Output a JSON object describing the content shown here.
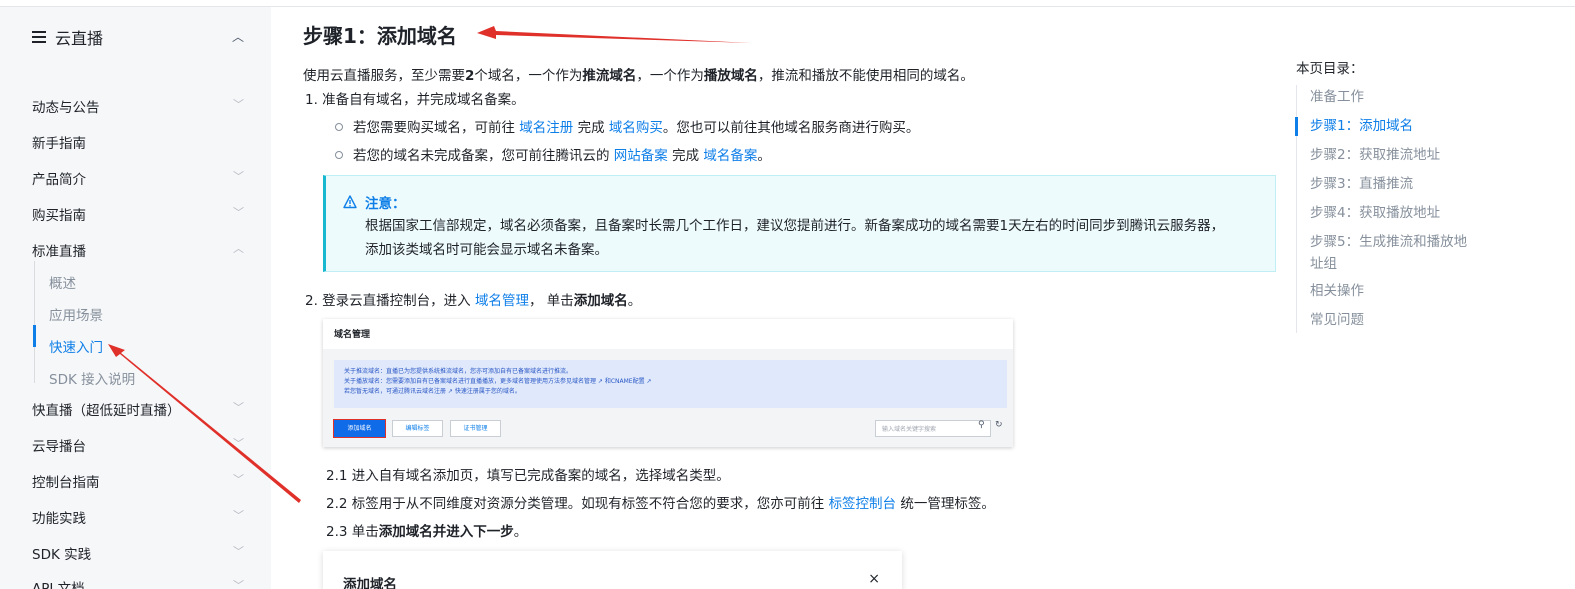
{
  "sidebar": {
    "title": "云直播",
    "items": [
      {
        "label": "动态与公告",
        "chevron": "down"
      },
      {
        "label": "新手指南",
        "chevron": ""
      },
      {
        "label": "产品简介",
        "chevron": "down"
      },
      {
        "label": "购买指南",
        "chevron": "down"
      },
      {
        "label": "标准直播",
        "chevron": "up"
      },
      {
        "label": "快直播（超低延时直播）",
        "chevron": "down"
      },
      {
        "label": "云导播台",
        "chevron": "down"
      },
      {
        "label": "控制台指南",
        "chevron": "down"
      },
      {
        "label": "功能实践",
        "chevron": "down"
      },
      {
        "label": "SDK 实践",
        "chevron": "down"
      },
      {
        "label": "API 文档",
        "chevron": "down"
      }
    ],
    "subitems": [
      "概述",
      "应用场景",
      "快速入门",
      "SDK 接入说明"
    ],
    "active_subitem": "快速入门"
  },
  "main": {
    "heading": "步骤1：添加域名",
    "intro": {
      "a": "使用云直播服务，至少需要",
      "b": "2",
      "c": "个域名，一个作为",
      "d": "推流域名",
      "e": "，一个作为",
      "f": "播放域名",
      "g": "，推流和播放不能使用相同的域名。"
    },
    "step1": "1. 准备自有域名，并完成域名备案。",
    "bullet1": {
      "a": "若您需要购买域名，可前往",
      "link1": "域名注册",
      "b": "完成",
      "link2": "域名购买",
      "c": "。您也可以前往其他域名服务商进行购买。"
    },
    "bullet2": {
      "a": "若您的域名未完成备案，您可前往腾讯云的",
      "link1": "网站备案",
      "b": "完成",
      "link2": "域名备案",
      "c": "。"
    },
    "notice": {
      "title": "注意：",
      "line1": "根据国家工信部规定，域名必须备案，且备案时长需几个工作日，建议您提前进行。新备案成功的域名需要1天左右的时间同步到腾讯云服务器，",
      "line2": "添加该类域名时可能会显示域名未备案。"
    },
    "step2": {
      "a": "2. 登录云直播控制台，进入",
      "link": "域名管理",
      "b": "， 单击",
      "c": "添加域名",
      "d": "。"
    },
    "screenshot": {
      "title": "域名管理",
      "info1": "关于推流域名：直播已为您提供系统推流域名，您亦可添加自有已备案域名进行推流。",
      "info2": "关于播放域名：您需要添加自有已备案域名进行直播播放，更多域名管理使用方法参见域名管理 ↗  和CNAME配置 ↗",
      "info3": "若您暂无域名，可通过腾讯云域名注册 ↗  快速注册属于您的域名。",
      "btn_add": "添加域名",
      "btn_tag": "编辑标签",
      "btn_cert": "证书管理",
      "search_placeholder": "输入域名关键字搜索"
    },
    "sub21": "2.1  进入自有域名添加页，填写已完成备案的域名，选择域名类型。",
    "sub22": {
      "a": "2.2  标签用于从不同维度对资源分类管理。如现有标签不符合您的要求，您亦可前往",
      "link": "标签控制台",
      "b": "统一管理标签。"
    },
    "sub23": {
      "a": "2.3  单击",
      "b": "添加域名并进入下一步",
      "c": "。"
    },
    "dialog": {
      "title": "添加域名",
      "close": "×"
    }
  },
  "toc": {
    "title": "本页目录：",
    "items": [
      "准备工作",
      "步骤1：添加域名",
      "步骤2：获取推流地址",
      "步骤3：直播推流",
      "步骤4：获取播放地址",
      "步骤5：生成推流和播放地址组",
      "相关操作",
      "常见问题"
    ],
    "active": "步骤1：添加域名"
  },
  "colors": {
    "accent": "#0f7fe8",
    "annotation": "#e0302a",
    "notice_bg": "#eefbfd"
  },
  "icons": [
    "menu-icon",
    "chevron-up-icon",
    "chevron-down-icon",
    "warning-icon",
    "search-icon",
    "refresh-icon",
    "close-icon"
  ]
}
